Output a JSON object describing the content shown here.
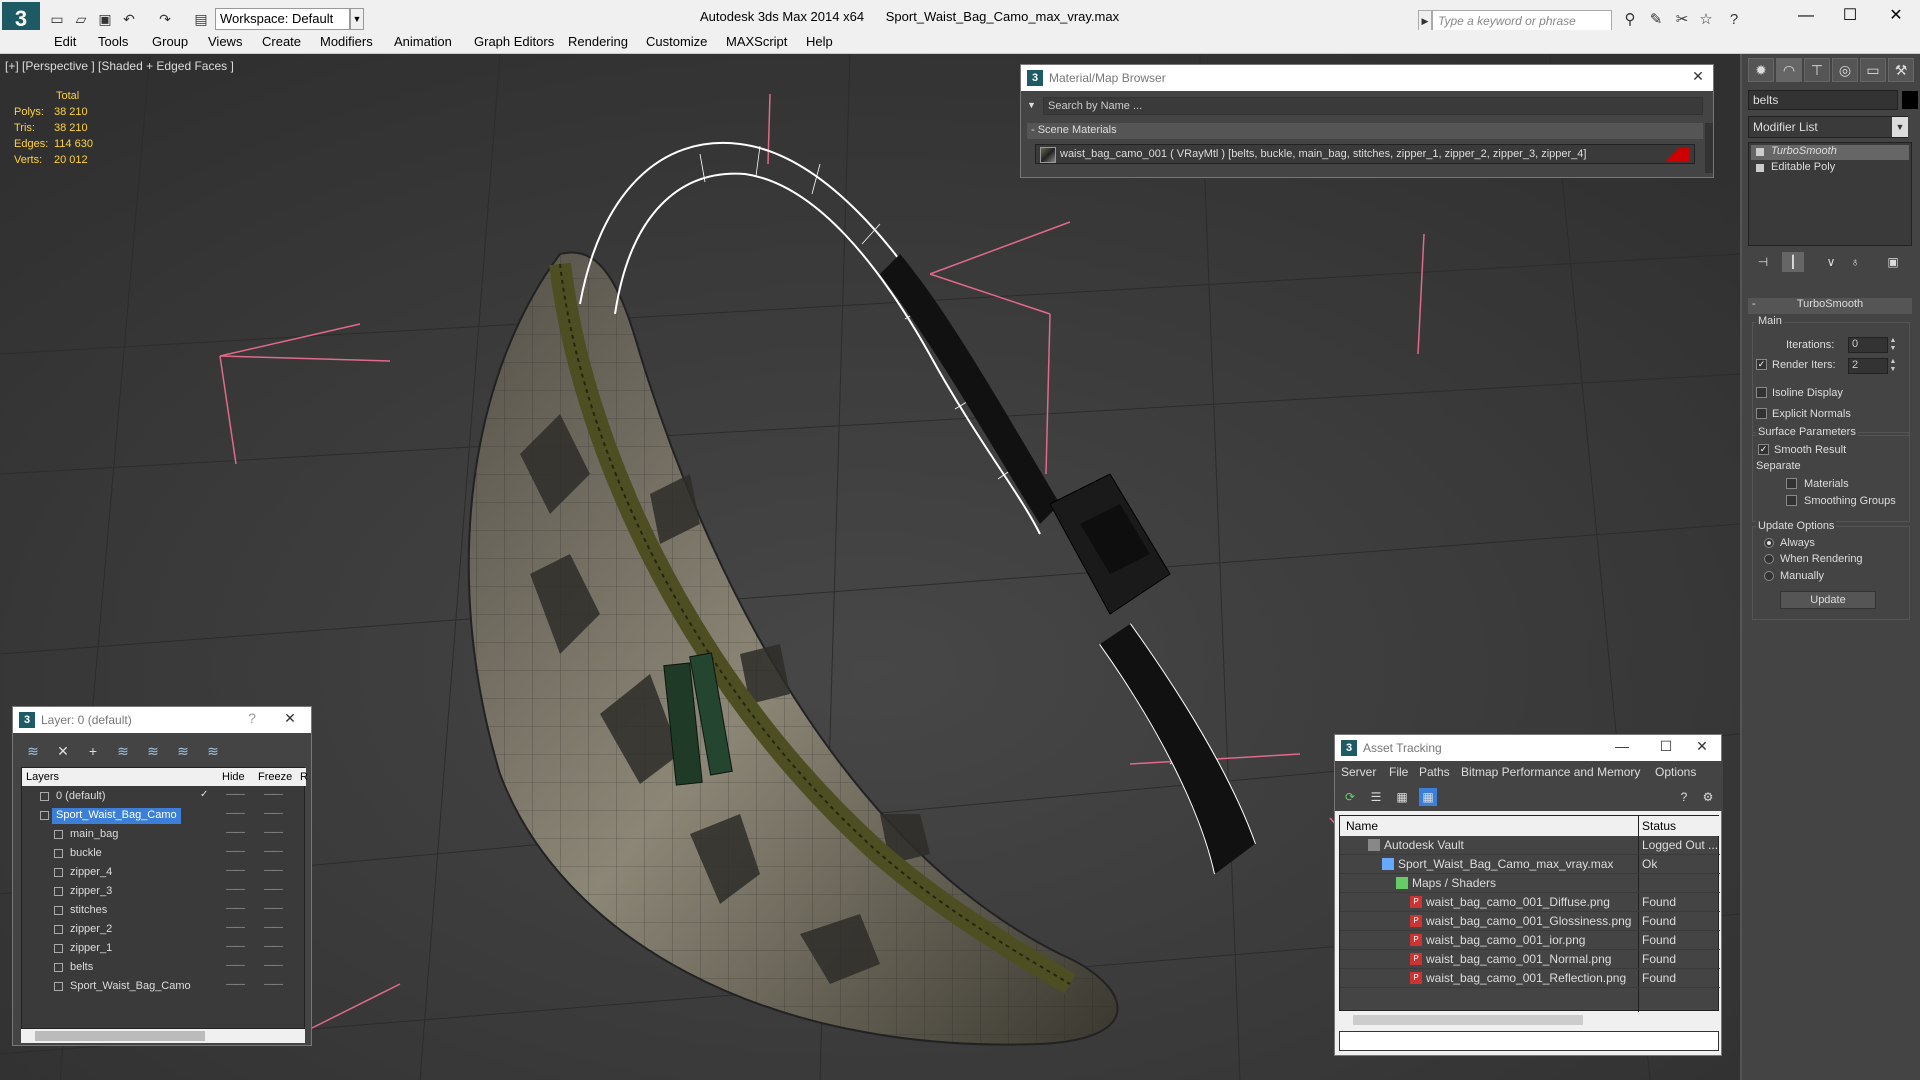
{
  "titlebar": {
    "workspace": "Workspace: Default",
    "app_name": "Autodesk 3ds Max  2014 x64",
    "file_name": "Sport_Waist_Bag_Camo_max_vray.max",
    "search_placeholder": "Type a keyword or phrase"
  },
  "menu": [
    "Edit",
    "Tools",
    "Group",
    "Views",
    "Create",
    "Modifiers",
    "Animation",
    "Graph Editors",
    "Rendering",
    "Customize",
    "MAXScript",
    "Help"
  ],
  "viewport": {
    "label": "[+] [Perspective ] [Shaded + Edged Faces ]",
    "stats": {
      "total_label": "Total",
      "rows": [
        {
          "label": "Polys:",
          "value": "38 210"
        },
        {
          "label": "Tris:",
          "value": "38 210"
        },
        {
          "label": "Edges:",
          "value": "114 630"
        },
        {
          "label": "Verts:",
          "value": "20 012"
        }
      ]
    }
  },
  "material_browser": {
    "title": "Material/Map Browser",
    "search_placeholder": "Search by Name ...",
    "section": "- Scene Materials",
    "material": "waist_bag_camo_001  ( VRayMtl )  [belts, buckle, main_bag, stitches, zipper_1, zipper_2, zipper_3, zipper_4]"
  },
  "command_panel": {
    "object_name": "belts",
    "modifier_list": "Modifier List",
    "stack": [
      "TurboSmooth",
      "Editable Poly"
    ],
    "turbosmooth": {
      "title": "TurboSmooth",
      "main": "Main",
      "iterations_label": "Iterations:",
      "iterations": "0",
      "render_iters_label": "Render Iters:",
      "render_iters": "2",
      "isoline": "Isoline Display",
      "explicit_normals": "Explicit Normals",
      "surface_params": "Surface Parameters",
      "smooth_result": "Smooth Result",
      "separate": "Separate",
      "materials": "Materials",
      "smoothing_groups": "Smoothing Groups",
      "update_options": "Update Options",
      "always": "Always",
      "when_rendering": "When Rendering",
      "manually": "Manually",
      "update_btn": "Update"
    }
  },
  "layer_dialog": {
    "title": "Layer: 0 (default)",
    "help": "?",
    "columns": {
      "layers": "Layers",
      "hide": "Hide",
      "freeze": "Freeze",
      "render": "R"
    },
    "rows": [
      {
        "name": "0 (default)",
        "indent": 1
      },
      {
        "name": "Sport_Waist_Bag_Camo",
        "indent": 1
      },
      {
        "name": "main_bag",
        "indent": 2
      },
      {
        "name": "buckle",
        "indent": 2
      },
      {
        "name": "zipper_4",
        "indent": 2
      },
      {
        "name": "zipper_3",
        "indent": 2
      },
      {
        "name": "stitches",
        "indent": 2
      },
      {
        "name": "zipper_2",
        "indent": 2
      },
      {
        "name": "zipper_1",
        "indent": 2
      },
      {
        "name": "belts",
        "indent": 2
      },
      {
        "name": "Sport_Waist_Bag_Camo",
        "indent": 2
      }
    ]
  },
  "asset_dialog": {
    "title": "Asset Tracking",
    "menu": [
      "Server",
      "File",
      "Paths",
      "Bitmap Performance and Memory",
      "Options"
    ],
    "col_name": "Name",
    "col_status": "Status",
    "rows": [
      {
        "name": "Autodesk Vault",
        "status": "Logged Out ...",
        "indent": 1
      },
      {
        "name": "Sport_Waist_Bag_Camo_max_vray.max",
        "status": "Ok",
        "indent": 2
      },
      {
        "name": "Maps / Shaders",
        "status": "",
        "indent": 3
      },
      {
        "name": "waist_bag_camo_001_Diffuse.png",
        "status": "Found",
        "indent": 4
      },
      {
        "name": "waist_bag_camo_001_Glossiness.png",
        "status": "Found",
        "indent": 4
      },
      {
        "name": "waist_bag_camo_001_ior.png",
        "status": "Found",
        "indent": 4
      },
      {
        "name": "waist_bag_camo_001_Normal.png",
        "status": "Found",
        "indent": 4
      },
      {
        "name": "waist_bag_camo_001_Reflection.png",
        "status": "Found",
        "indent": 4
      }
    ]
  },
  "colors": {
    "selection": "#3b7fd9",
    "stats_text": "#ffd23a",
    "viewport_bg": "#3c3c3c"
  }
}
